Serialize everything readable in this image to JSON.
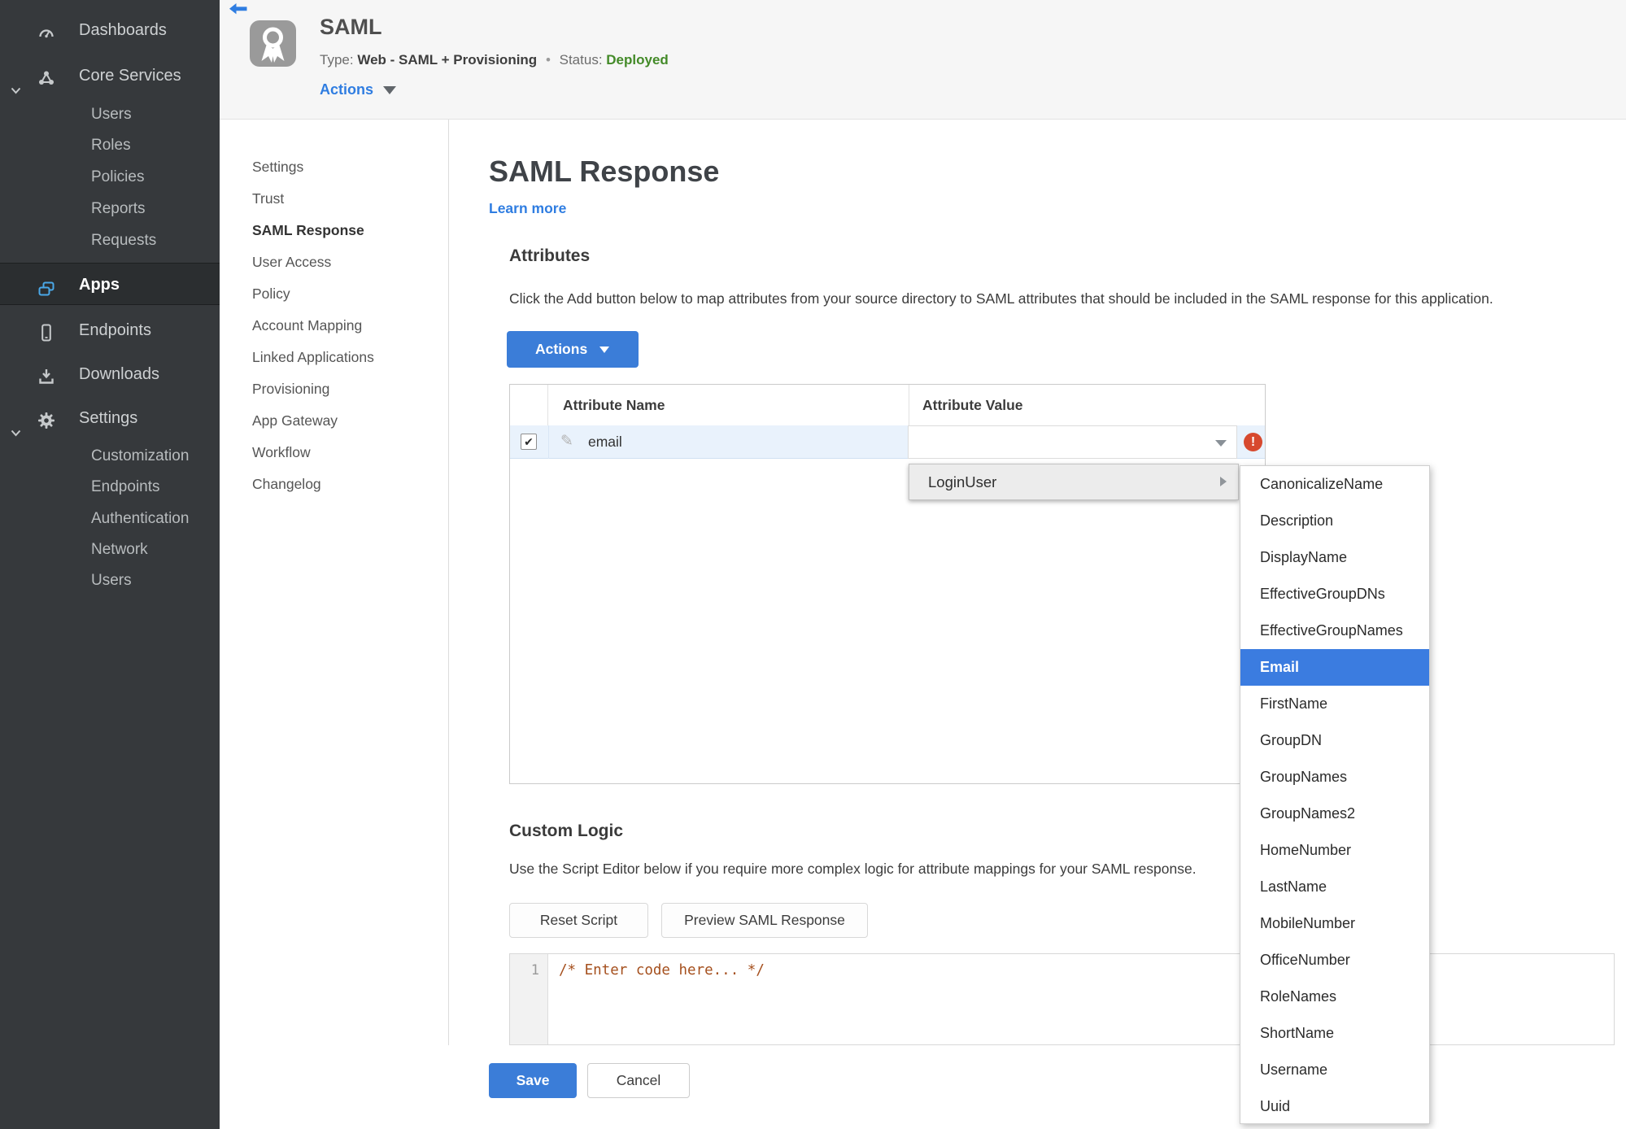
{
  "sidebar": {
    "items": [
      {
        "label": "Dashboards",
        "icon": "dashboard"
      },
      {
        "label": "Core Services",
        "icon": "core-services"
      },
      {
        "label": "Users"
      },
      {
        "label": "Roles"
      },
      {
        "label": "Policies"
      },
      {
        "label": "Reports"
      },
      {
        "label": "Requests"
      },
      {
        "label": "Apps",
        "icon": "apps",
        "active": true
      },
      {
        "label": "Endpoints",
        "icon": "endpoints"
      },
      {
        "label": "Downloads",
        "icon": "downloads"
      },
      {
        "label": "Settings",
        "icon": "settings"
      },
      {
        "label": "Customization"
      },
      {
        "label": "Endpoints"
      },
      {
        "label": "Authentication"
      },
      {
        "label": "Network"
      },
      {
        "label": "Users"
      }
    ]
  },
  "header": {
    "title": "SAML",
    "type_label": "Type:",
    "type_value": "Web - SAML + Provisioning",
    "dot": "•",
    "status_label": "Status:",
    "status_value": "Deployed",
    "actions_label": "Actions"
  },
  "nav": {
    "items": [
      "Settings",
      "Trust",
      "SAML Response",
      "User Access",
      "Policy",
      "Account Mapping",
      "Linked Applications",
      "Provisioning",
      "App Gateway",
      "Workflow",
      "Changelog"
    ],
    "active": "SAML Response"
  },
  "main": {
    "title": "SAML Response",
    "learn_more": "Learn more",
    "attributes": {
      "heading": "Attributes",
      "description": "Click the Add button below to map attributes from your source directory to SAML attributes that should be included in the SAML response for this application.",
      "actions_button": "Actions",
      "table": {
        "col_name": "Attribute Name",
        "col_value": "Attribute Value",
        "row": {
          "name": "email",
          "value": "",
          "checked": true
        }
      }
    },
    "value_menu": {
      "item": "LoginUser",
      "submenu": {
        "items": [
          "CanonicalizeName",
          "Description",
          "DisplayName",
          "EffectiveGroupDNs",
          "EffectiveGroupNames",
          "Email",
          "FirstName",
          "GroupDN",
          "GroupNames",
          "GroupNames2",
          "HomeNumber",
          "LastName",
          "MobileNumber",
          "OfficeNumber",
          "RoleNames",
          "ShortName",
          "Username",
          "Uuid"
        ],
        "selected": "Email"
      }
    },
    "custom_logic": {
      "heading": "Custom Logic",
      "description": "Use the Script Editor below if you require more complex logic for attribute mappings for your SAML response.",
      "reset_button": "Reset Script",
      "preview_button": "Preview SAML Response",
      "editor": {
        "line_number": "1",
        "code": "/* Enter code here... */"
      }
    },
    "save_button": "Save",
    "cancel_button": "Cancel"
  },
  "icons": {
    "pencil": "✎",
    "check": "✔",
    "error": "!"
  },
  "colors": {
    "accent_blue": "#2f7de1",
    "button_blue": "#3b7dd8",
    "status_green": "#438a28",
    "error_red": "#d7492e",
    "selection_blue": "#3b7ce0",
    "row_highlight": "#e9f2fc",
    "sidebar_bg": "#36393c"
  }
}
